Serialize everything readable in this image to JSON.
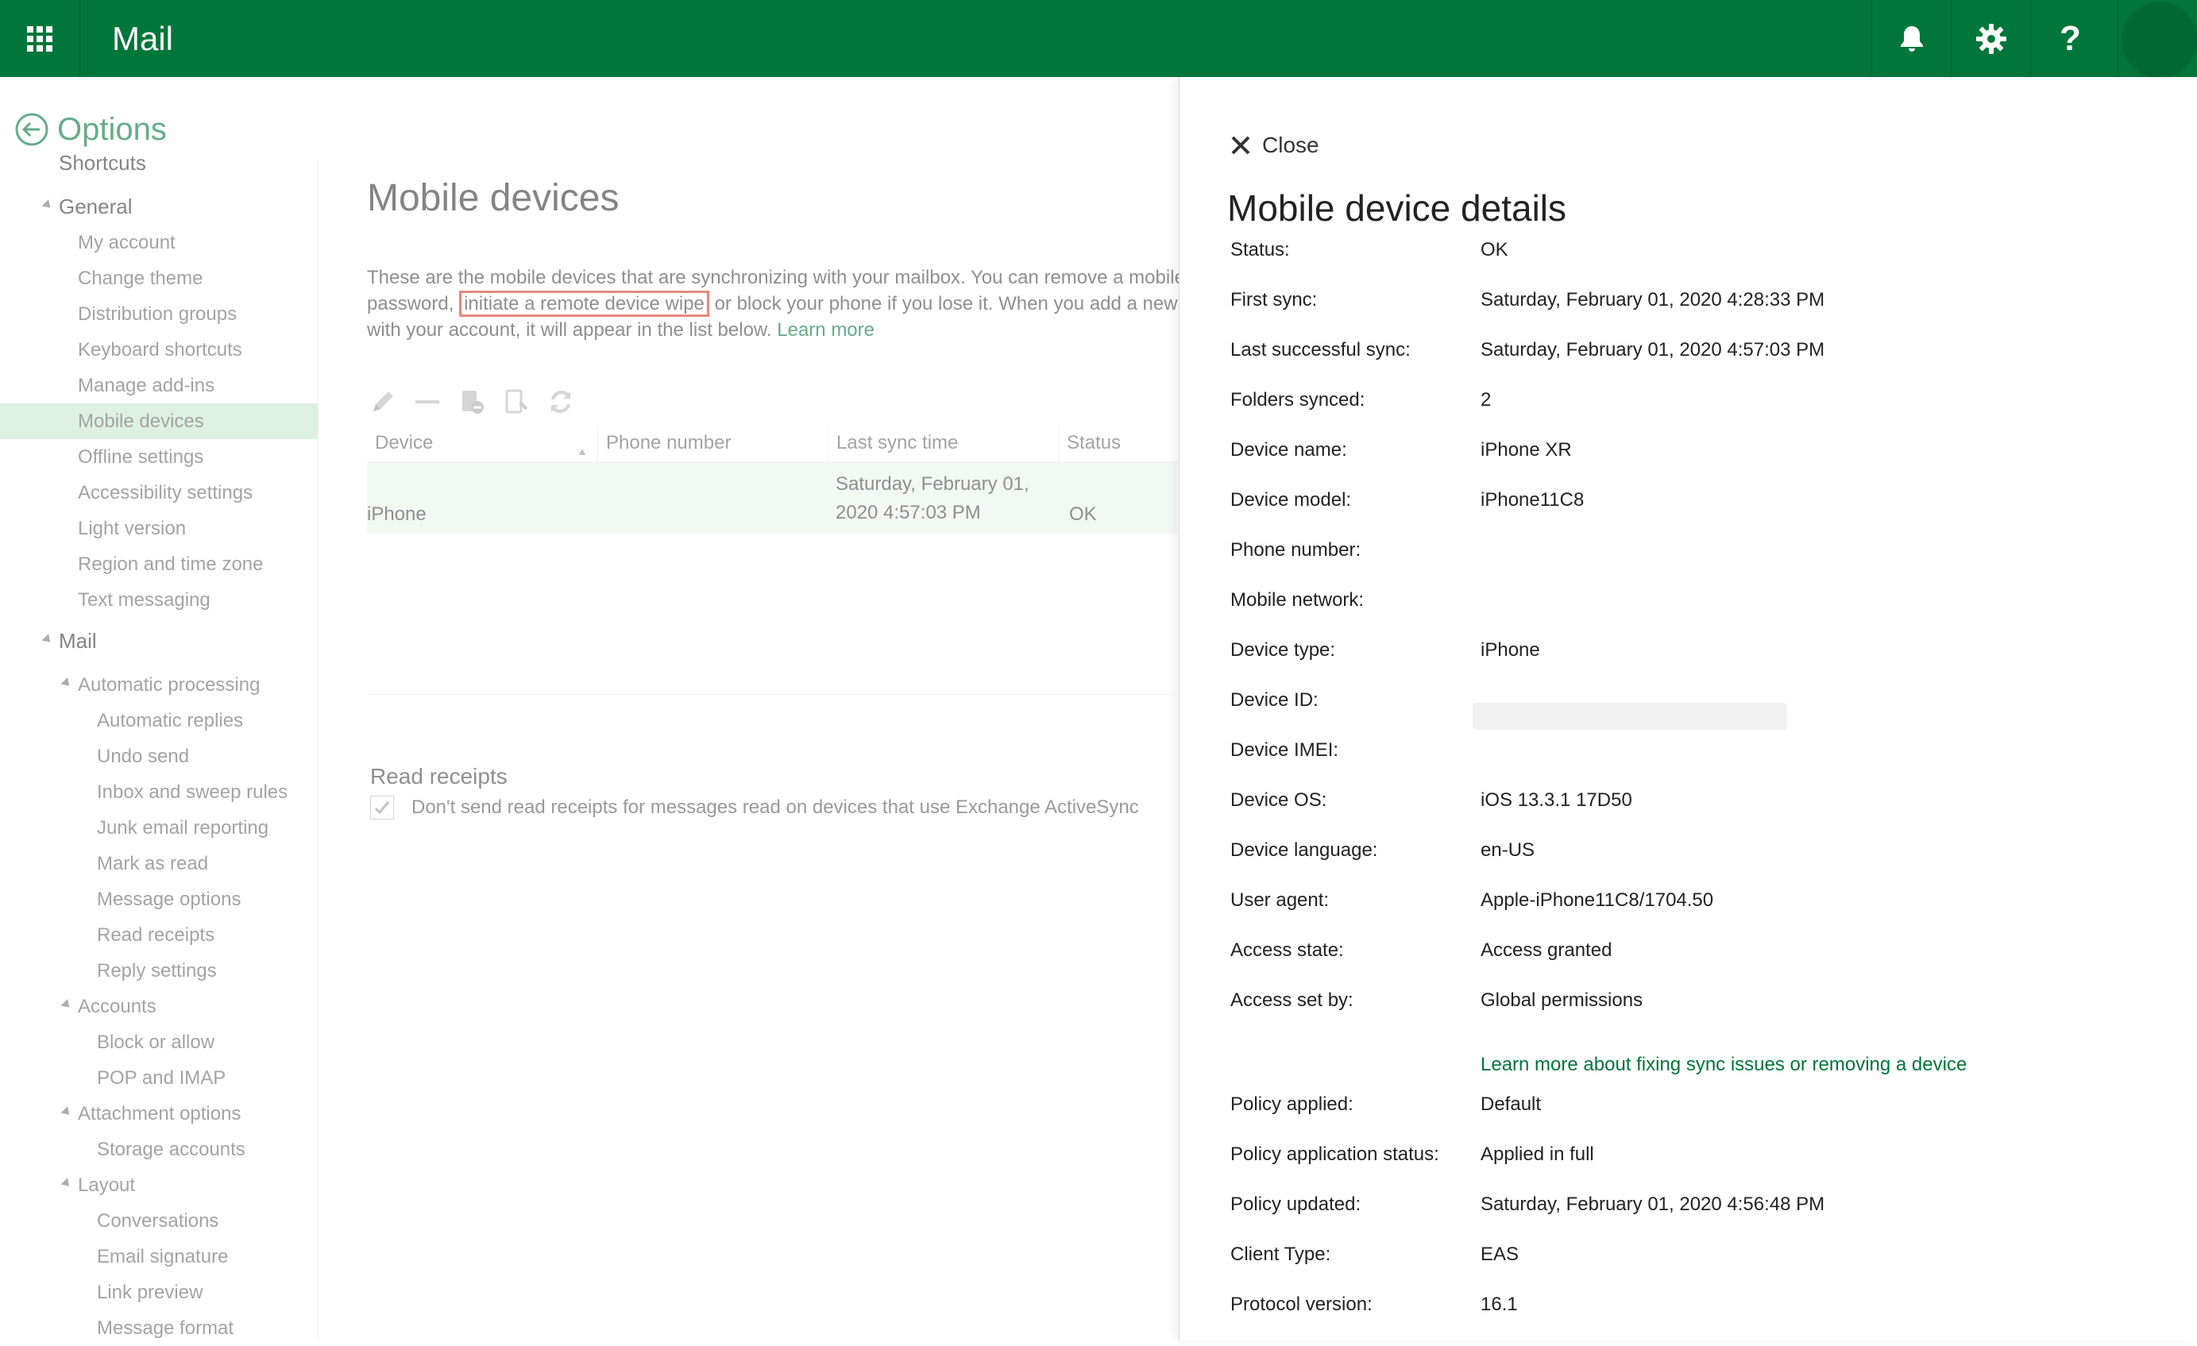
{
  "topbar": {
    "app_title": "Mail",
    "icons": [
      "app-launcher-icon",
      "bell-icon",
      "gear-icon",
      "help-icon",
      "avatar"
    ],
    "help_glyph": "?",
    "brand_color": "#00763a"
  },
  "options": {
    "back_title": "Options",
    "nav": [
      {
        "label": "Shortcuts",
        "level": 0,
        "expandable": false
      },
      {
        "label": "General",
        "level": 0,
        "expandable": true
      },
      {
        "label": "My account",
        "level": 1
      },
      {
        "label": "Change theme",
        "level": 1
      },
      {
        "label": "Distribution groups",
        "level": 1
      },
      {
        "label": "Keyboard shortcuts",
        "level": 1
      },
      {
        "label": "Manage add-ins",
        "level": 1
      },
      {
        "label": "Mobile devices",
        "level": 1,
        "selected": true
      },
      {
        "label": "Offline settings",
        "level": 1
      },
      {
        "label": "Accessibility settings",
        "level": 1
      },
      {
        "label": "Light version",
        "level": 1
      },
      {
        "label": "Region and time zone",
        "level": 1
      },
      {
        "label": "Text messaging",
        "level": 1
      },
      {
        "label": "Mail",
        "level": 0,
        "expandable": true
      },
      {
        "label": "Automatic processing",
        "level": 1,
        "expandable": true
      },
      {
        "label": "Automatic replies",
        "level": 2
      },
      {
        "label": "Undo send",
        "level": 2
      },
      {
        "label": "Inbox and sweep rules",
        "level": 2
      },
      {
        "label": "Junk email reporting",
        "level": 2
      },
      {
        "label": "Mark as read",
        "level": 2
      },
      {
        "label": "Message options",
        "level": 2
      },
      {
        "label": "Read receipts",
        "level": 2
      },
      {
        "label": "Reply settings",
        "level": 2
      },
      {
        "label": "Accounts",
        "level": 1,
        "expandable": true
      },
      {
        "label": "Block or allow",
        "level": 2
      },
      {
        "label": "POP and IMAP",
        "level": 2
      },
      {
        "label": "Attachment options",
        "level": 1,
        "expandable": true
      },
      {
        "label": "Storage accounts",
        "level": 2
      },
      {
        "label": "Layout",
        "level": 1,
        "expandable": true
      },
      {
        "label": "Conversations",
        "level": 2
      },
      {
        "label": "Email signature",
        "level": 2
      },
      {
        "label": "Link preview",
        "level": 2
      },
      {
        "label": "Message format",
        "level": 2
      }
    ]
  },
  "main": {
    "title": "Mobile devices",
    "desc": {
      "line1": "These are the mobile devices that are synchronizing with your mailbox. You can remove a mobile",
      "line2_pre": "password,",
      "line2_link": "initiate a remote device wipe",
      "line2_post": "or block your phone if you lose it. When you add a new",
      "line3": "with your account, it will appear in the list below.",
      "learn_more": "Learn more"
    },
    "toolbar_icons": [
      "edit-icon",
      "remove-icon",
      "block-icon",
      "wipe-icon",
      "refresh-icon"
    ],
    "table": {
      "columns": [
        "Device",
        "Phone number",
        "Last sync time",
        "Status"
      ],
      "rows": [
        {
          "device": "iPhone",
          "phone": "",
          "last_sync_line1": "Saturday, February 01,",
          "last_sync_line2": "2020 4:57:03 PM",
          "status": "OK"
        }
      ]
    },
    "read_receipts": {
      "title": "Read receipts",
      "checkbox_label": "Don't send read receipts for messages read on devices that use Exchange ActiveSync",
      "checked": true
    }
  },
  "panel": {
    "close_label": "Close",
    "title": "Mobile device details",
    "fields": [
      {
        "label": "Status:",
        "value": "OK"
      },
      {
        "label": "First sync:",
        "value": "Saturday, February 01, 2020 4:28:33 PM"
      },
      {
        "label": "Last successful sync:",
        "value": "Saturday, February 01, 2020 4:57:03 PM"
      },
      {
        "label": "Folders synced:",
        "value": "2"
      },
      {
        "label": "Device name:",
        "value": "iPhone XR"
      },
      {
        "label": "Device model:",
        "value": "iPhone11C8"
      },
      {
        "label": "Phone number:",
        "value": ""
      },
      {
        "label": "Mobile network:",
        "value": ""
      },
      {
        "label": "Device type:",
        "value": "iPhone"
      },
      {
        "label": "Device ID:",
        "value": ""
      },
      {
        "label": "Device IMEI:",
        "value": ""
      },
      {
        "label": "Device OS:",
        "value": "iOS 13.3.1 17D50"
      },
      {
        "label": "Device language:",
        "value": "en-US"
      },
      {
        "label": "User agent:",
        "value": "Apple-iPhone11C8/1704.50"
      },
      {
        "label": "Access state:",
        "value": "Access granted"
      },
      {
        "label": "Access set by:",
        "value": "Global permissions"
      },
      {
        "label": "Policy applied:",
        "value": "Default"
      },
      {
        "label": "Policy application status:",
        "value": "Applied in full"
      },
      {
        "label": "Policy updated:",
        "value": "Saturday, February 01, 2020 4:56:48 PM"
      },
      {
        "label": "Client Type:",
        "value": "EAS"
      },
      {
        "label": "Protocol version:",
        "value": "16.1"
      }
    ],
    "help_link": "Learn more about fixing sync issues or removing a device"
  }
}
